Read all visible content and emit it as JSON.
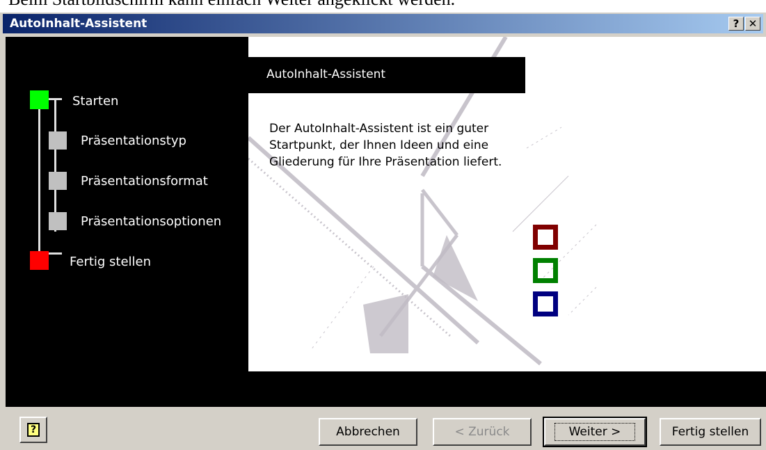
{
  "caption": "Beim Startbildschirm kann einfach Weiter angeklickt werden.",
  "window": {
    "title": "AutoInhalt-Assistent",
    "help_glyph": "?",
    "close_glyph": "✕"
  },
  "steps": [
    {
      "label": "Starten",
      "state": "current",
      "color": "#00ff00"
    },
    {
      "label": "Präsentationstyp",
      "state": "pending",
      "color": "#c0c0c0"
    },
    {
      "label": "Präsentationsformat",
      "state": "pending",
      "color": "#c0c0c0"
    },
    {
      "label": "Präsentationsoptionen",
      "state": "pending",
      "color": "#c0c0c0"
    },
    {
      "label": "Fertig stellen",
      "state": "end",
      "color": "#ff0000"
    }
  ],
  "content": {
    "heading": "AutoInhalt-Assistent",
    "body_lines": [
      "Der AutoInhalt-Assistent ist ein guter",
      "Startpunkt, der Ihnen Ideen und eine",
      "Gliederung für Ihre Präsentation liefert."
    ],
    "deco_colors": [
      "#800000",
      "#008000",
      "#000080"
    ]
  },
  "buttons": {
    "help_icon": "?",
    "cancel": "Abbrechen",
    "back": "< Zurück",
    "next": "Weiter >",
    "finish": "Fertig stellen"
  }
}
